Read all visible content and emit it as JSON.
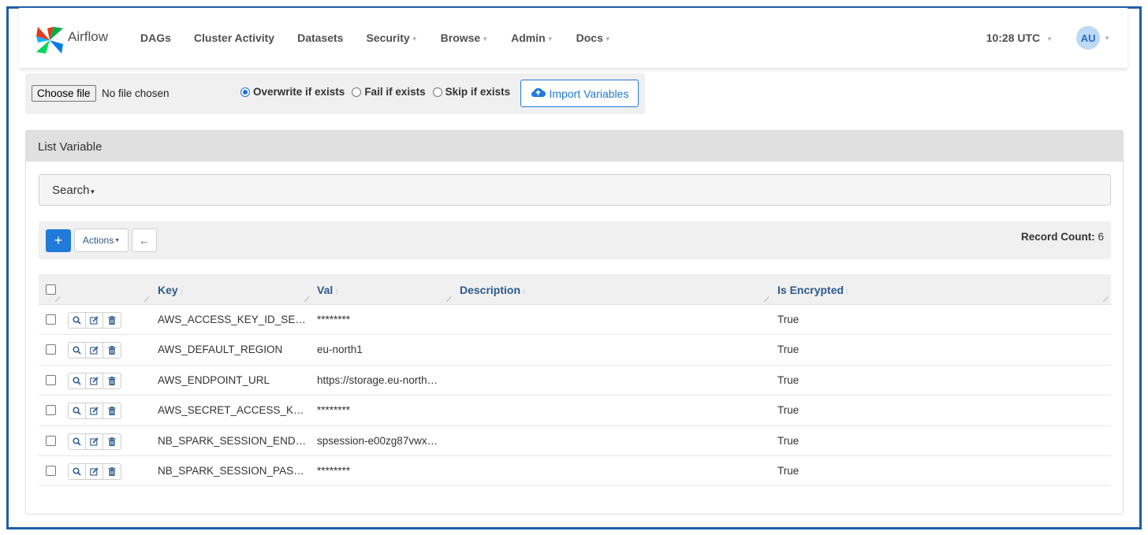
{
  "brand": {
    "name": "Airflow"
  },
  "nav": {
    "items": [
      {
        "label": "DAGs",
        "dropdown": false
      },
      {
        "label": "Cluster Activity",
        "dropdown": false
      },
      {
        "label": "Datasets",
        "dropdown": false
      },
      {
        "label": "Security",
        "dropdown": true
      },
      {
        "label": "Browse",
        "dropdown": true
      },
      {
        "label": "Admin",
        "dropdown": true
      },
      {
        "label": "Docs",
        "dropdown": true
      }
    ],
    "time": "10:28 UTC",
    "user_initials": "AU"
  },
  "import": {
    "choose_file_label": "Choose file",
    "no_file_text": "No file chosen",
    "options": [
      {
        "label": "Overwrite if exists",
        "checked": true
      },
      {
        "label": "Fail if exists",
        "checked": false
      },
      {
        "label": "Skip if exists",
        "checked": false
      }
    ],
    "button_label": "Import Variables"
  },
  "panel": {
    "title": "List Variable",
    "search_label": "Search",
    "actions_label": "Actions",
    "add_label": "+",
    "back_label": "←",
    "record_count_label": "Record Count:",
    "record_count_value": "6"
  },
  "table": {
    "columns": [
      "Key",
      "Val",
      "Description",
      "Is Encrypted"
    ],
    "rows": [
      {
        "key": "AWS_ACCESS_KEY_ID_SE…",
        "val": "********",
        "description": "",
        "encrypted": "True"
      },
      {
        "key": "AWS_DEFAULT_REGION",
        "val": "eu-north1",
        "description": "",
        "encrypted": "True"
      },
      {
        "key": "AWS_ENDPOINT_URL",
        "val": "https://storage.eu-north…",
        "description": "",
        "encrypted": "True"
      },
      {
        "key": "AWS_SECRET_ACCESS_K…",
        "val": "********",
        "description": "",
        "encrypted": "True"
      },
      {
        "key": "NB_SPARK_SESSION_END…",
        "val": "spsession-e00zg87vwx…",
        "description": "",
        "encrypted": "True"
      },
      {
        "key": "NB_SPARK_SESSION_PAS…",
        "val": "********",
        "description": "",
        "encrypted": "True"
      }
    ]
  },
  "colors": {
    "frame": "#1f5fa8",
    "primary": "#1f7ad9",
    "link": "#2c5a8c"
  }
}
